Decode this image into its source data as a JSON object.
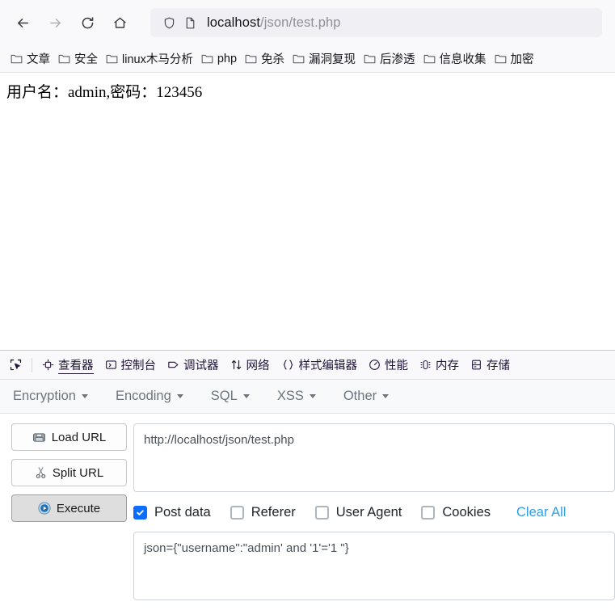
{
  "browser": {
    "nav": {
      "back": "back-arrow",
      "forward": "forward-arrow",
      "reload": "reload",
      "home": "home"
    },
    "urlbar": {
      "shield_icon": "shield-icon",
      "page_icon": "page-icon",
      "host": "localhost",
      "path": "/json/test.php",
      "full_url": "localhost/json/test.php"
    },
    "bookmarks": [
      {
        "label": "文章"
      },
      {
        "label": "安全"
      },
      {
        "label": "linux木马分析"
      },
      {
        "label": "php"
      },
      {
        "label": "免杀"
      },
      {
        "label": "漏洞复现"
      },
      {
        "label": "后渗透"
      },
      {
        "label": "信息收集"
      },
      {
        "label": "加密"
      }
    ]
  },
  "page": {
    "body_text": "用户名：admin,密码：123456"
  },
  "devtools": {
    "picker": "element-picker",
    "tabs": [
      {
        "label": "查看器",
        "icon": "inspector-icon",
        "selected": true
      },
      {
        "label": "控制台",
        "icon": "console-icon",
        "selected": false
      },
      {
        "label": "调试器",
        "icon": "debugger-icon",
        "selected": false
      },
      {
        "label": "网络",
        "icon": "network-icon",
        "selected": false
      },
      {
        "label": "样式编辑器",
        "icon": "style-editor-icon",
        "selected": false
      },
      {
        "label": "性能",
        "icon": "performance-icon",
        "selected": false
      },
      {
        "label": "内存",
        "icon": "memory-icon",
        "selected": false
      },
      {
        "label": "存储",
        "icon": "storage-icon",
        "selected": false
      }
    ]
  },
  "hackbar": {
    "menu": [
      {
        "label": "Encryption"
      },
      {
        "label": "Encoding"
      },
      {
        "label": "SQL"
      },
      {
        "label": "XSS"
      },
      {
        "label": "Other"
      }
    ],
    "buttons": [
      {
        "label": "Load URL",
        "icon": "load-url-icon",
        "pressed": false
      },
      {
        "label": "Split URL",
        "icon": "scissors-icon",
        "pressed": false
      },
      {
        "label": "Execute",
        "icon": "play-icon",
        "pressed": true
      }
    ],
    "url_value": "http://localhost/json/test.php",
    "url_placeholder": "",
    "options": [
      {
        "label": "Post data",
        "checked": true
      },
      {
        "label": "Referer",
        "checked": false
      },
      {
        "label": "User Agent",
        "checked": false
      },
      {
        "label": "Cookies",
        "checked": false
      }
    ],
    "clear_all_label": "Clear All",
    "post_data_value": "json={\"username\":\"admin' and '1'='1 \"}",
    "post_data_placeholder": ""
  },
  "colors": {
    "accent_blue": "#0d6efd",
    "link_blue": "#2f9fe8",
    "chrome_bg": "#f9f9fb",
    "urlbar_bg": "#f0f0f4",
    "hackbar_menu_bg": "#f8f9fa"
  }
}
